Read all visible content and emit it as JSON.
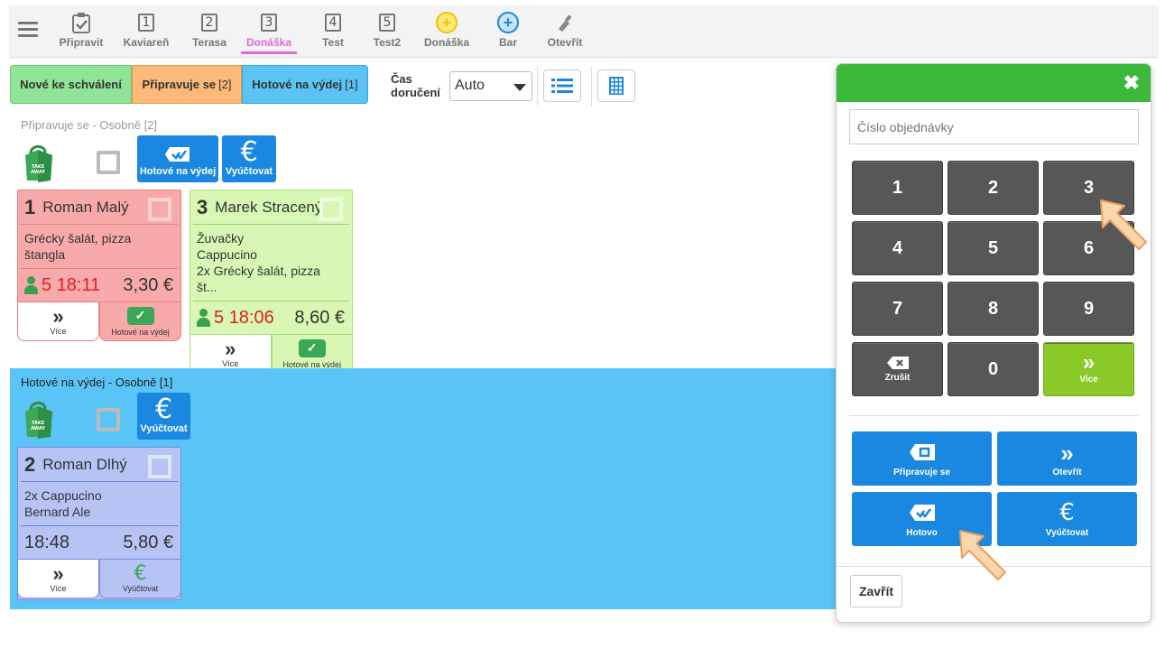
{
  "nav": {
    "items": [
      {
        "label": "Připravit"
      },
      {
        "label": "Kaviareň",
        "num": "1"
      },
      {
        "label": "Terasa",
        "num": "2"
      },
      {
        "label": "Donáška",
        "num": "3"
      },
      {
        "label": "Test",
        "num": "4"
      },
      {
        "label": "Test2",
        "num": "5"
      },
      {
        "label": "Donáška"
      },
      {
        "label": "Bar"
      },
      {
        "label": "Otevřít"
      }
    ],
    "active_index": 3,
    "accent_color": "#e06ad2"
  },
  "filters": {
    "new": {
      "label": "Nové ke schválení"
    },
    "preparing": {
      "label": "Připravuje se",
      "count": "[2]"
    },
    "ready": {
      "label": "Hotové na výdej",
      "count": "[1]"
    }
  },
  "delivery": {
    "label_line1": "Čas",
    "label_line2": "doručení",
    "value": "Auto"
  },
  "preparing_section": {
    "title": "Připravuje se - Osobně [2]",
    "btn_ready": "Hotové na výdej",
    "btn_pay": "Vyúčtovat",
    "euro": "€",
    "orders": [
      {
        "num": "1",
        "name": "Roman Malý",
        "items": [
          "Grécky šalát, pizza štangla"
        ],
        "person": "5",
        "time": "18:11",
        "price": "3,30 €",
        "more": "Více",
        "ready": "Hotové na výdej"
      },
      {
        "num": "3",
        "name": "Marek Stracený",
        "items": [
          "Žuvačky",
          "Cappucino",
          "2x Grécky šalát, pizza št..."
        ],
        "person": "5",
        "time": "18:06",
        "price": "8,60 €",
        "more": "Více",
        "ready": "Hotové na výdej"
      }
    ]
  },
  "ready_section": {
    "title": "Hotové na výdej - Osobně [1]",
    "btn_pay": "Vyúčtovat",
    "euro": "€",
    "orders": [
      {
        "num": "2",
        "name": "Roman Dlhý",
        "items": [
          "2x Cappucino",
          "Bernard Ale"
        ],
        "time": "18:48",
        "price": "5,80 €",
        "more": "Více",
        "pay": "Vyúčtovat"
      }
    ]
  },
  "modal": {
    "close": "✖",
    "input_placeholder": "Číslo objednávky",
    "keys": [
      "1",
      "2",
      "3",
      "4",
      "5",
      "6",
      "7",
      "8",
      "9"
    ],
    "key_cancel": "Zrušit",
    "key_zero": "0",
    "key_more": "Více",
    "actions": {
      "preparing": "Připravuje se",
      "open": "Otevřít",
      "done": "Hotovo",
      "pay": "Vyúčtovat"
    },
    "close_button": "Zavřít",
    "header_color": "#3cb83b"
  },
  "colors": {
    "blue_btn": "#1a88e0",
    "preparing_bg": "#fbba79",
    "ready_bg": "#5bc4f6",
    "new_bg": "#90e497"
  }
}
